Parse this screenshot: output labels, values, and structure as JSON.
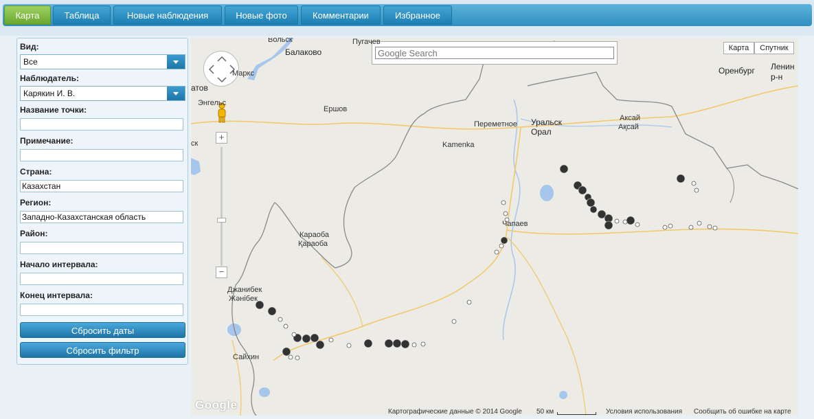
{
  "tabs": [
    {
      "label": "Карта"
    },
    {
      "label": "Таблица"
    },
    {
      "label": "Новые наблюдения"
    },
    {
      "label": "Новые фото"
    },
    {
      "label": "Комментарии"
    },
    {
      "label": "Избранное"
    }
  ],
  "filter": {
    "view_label": "Вид:",
    "view_value": "Все",
    "observer_label": "Наблюдатель:",
    "observer_value": "Карякин И.  В.",
    "point_name_label": "Название точки:",
    "point_name_value": "",
    "note_label": "Примечание:",
    "note_value": "",
    "country_label": "Страна:",
    "country_value": "Казахстан",
    "region_label": "Регион:",
    "region_value": "Западно-Казахстанская область",
    "district_label": "Район:",
    "district_value": "",
    "interval_start_label": "Начало интервала:",
    "interval_start_value": "",
    "interval_end_label": "Конец интервала:",
    "interval_end_value": "",
    "reset_dates_label": "Сбросить даты",
    "reset_filter_label": "Сбросить фильтр"
  },
  "map": {
    "search_placeholder": "Google Search",
    "type_map": "Карта",
    "type_satellite": "Спутник",
    "zoom_in": "+",
    "zoom_out": "−",
    "google_logo": "Google",
    "attribution": "Картографические данные © 2014 Google",
    "scale": "50 км",
    "terms": "Условия использования",
    "report": "Сообщить об ошибке на карте",
    "places": {
      "volsk": "Вольск",
      "balakovo": "Балаково",
      "pugachev": "Пугачев",
      "marks": "Маркс",
      "saratov": "атов",
      "engels": "Энгельс",
      "ershov": "Ершов",
      "peremetnoe": "Переметное",
      "kamenka": "Kamenka",
      "uralsk": "Уральск",
      "oral": "Орал",
      "aksai": "Аксай",
      "aksai_kz": "Ақсай",
      "orenburg": "Оренбург",
      "lenin": "Ленин",
      "lenin2": "р-н",
      "karaoba": "Караоба",
      "karaoba_kz": "Қараоба",
      "chapaev": "Чапаев",
      "dzhanibek": "Джанибек",
      "zhanibek": "Жәнібек",
      "saikhin": "Сайхин",
      "edge_sk": "ск"
    }
  }
}
